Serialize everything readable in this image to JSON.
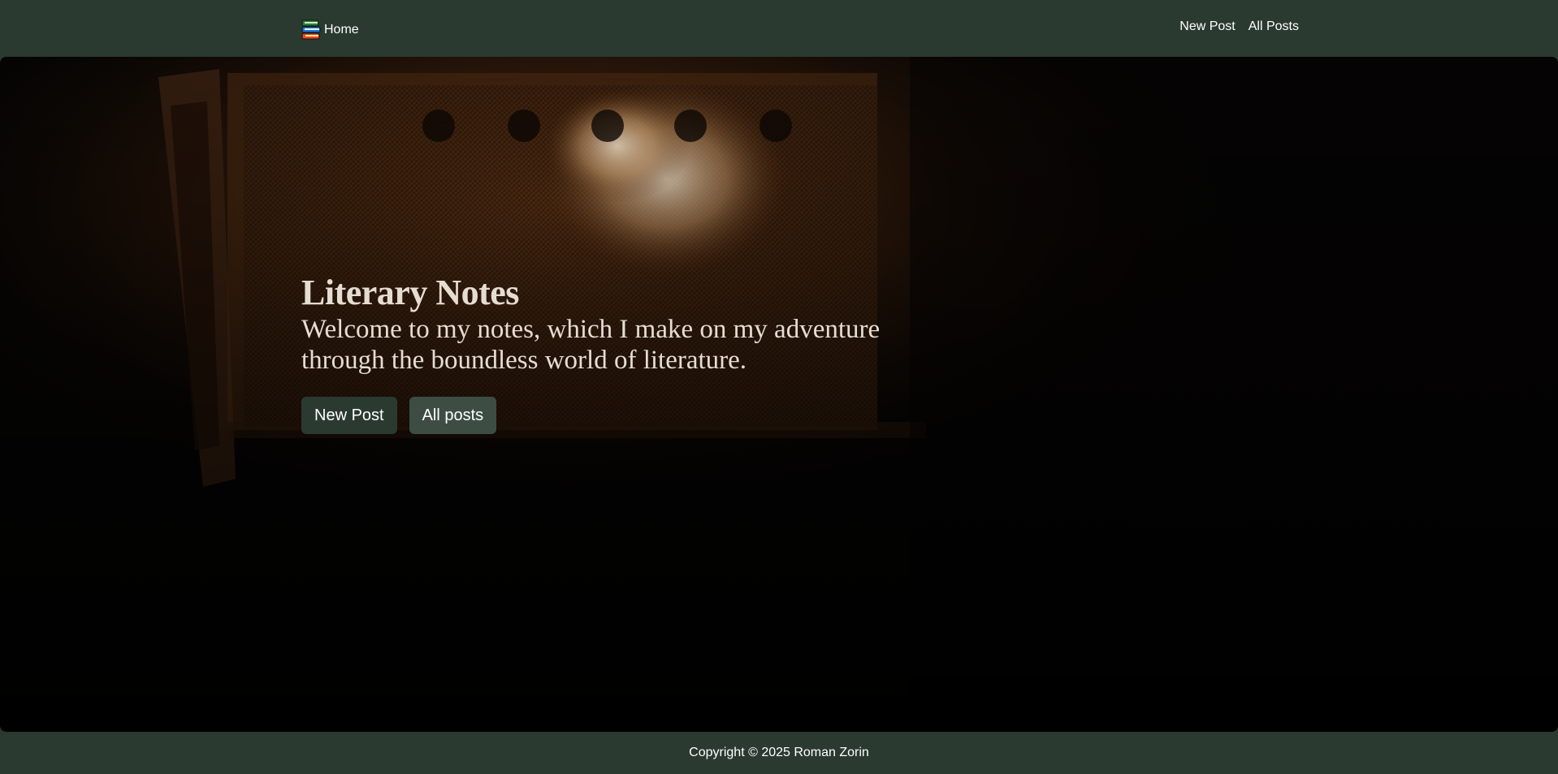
{
  "navbar": {
    "brand_icon": "books-icon",
    "brand_label": "Home",
    "links": [
      {
        "label": "New Post"
      },
      {
        "label": "All Posts"
      }
    ],
    "background": "#2b3a30"
  },
  "hero": {
    "title": "Literary Notes",
    "subtitle": "Welcome to my notes, which I make on my adventure through the boundless world of literature.",
    "buttons": [
      {
        "label": "New Post",
        "color": "#2b3a30"
      },
      {
        "label": "All posts",
        "color": "#3d4d43"
      }
    ],
    "background_image": "fireplace-photo"
  },
  "footer": {
    "text": "Copyright © 2025 Roman Zorin"
  }
}
